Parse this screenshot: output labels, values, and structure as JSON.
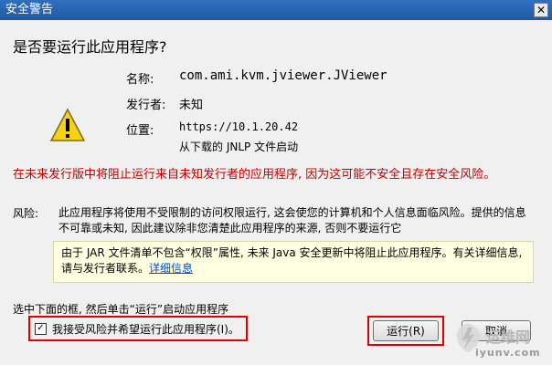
{
  "window": {
    "title": "安全警告"
  },
  "icons": {
    "warning": "warning-triangle-icon",
    "close": "close-icon",
    "checkbox": "check-icon"
  },
  "heading": "是否要运行此应用程序?",
  "fields": {
    "name_label": "名称:",
    "name_value": "com.ami.kvm.jviewer.JViewer",
    "publisher_label": "发行者:",
    "publisher_value": "未知",
    "location_label": "位置:",
    "location_value": "https://10.1.20.42",
    "launch_note": "从下载的 JNLP 文件启动"
  },
  "warning_text": "在未来发行版中将阻止运行来自未知发行者的应用程序, 因为这可能不安全且存在安全风险。",
  "risk": {
    "label": "风险:",
    "text": "此应用程序将使用不受限制的访问权限运行, 这会使您的计算机和个人信息面临风险。提供的信息不可靠或未知, 因此建议除非您清楚此应用程序的来源, 否则不要运行它"
  },
  "info_box": {
    "text": "由于 JAR 文件清单不包含“权限”属性, 未来 Java 安全更新中将阻止此应用程序。有关详细信息, 请与发行者联系。",
    "link": "详细信息"
  },
  "instruction": "选中下面的框, 然后单击“运行”启动应用程序",
  "checkbox": {
    "label": "我接受风险并希望运行此应用程序(I)。",
    "checked": true
  },
  "buttons": {
    "run": "运行(R)",
    "cancel": "取消"
  },
  "watermark": {
    "top": "运维网",
    "bottom": "iyunv.com"
  },
  "colors": {
    "title_bar": "#1f5aa6",
    "warning_text": "#c00000",
    "highlight": "#e00000",
    "info_bg": "#ffffe1",
    "link": "#0050c8"
  }
}
